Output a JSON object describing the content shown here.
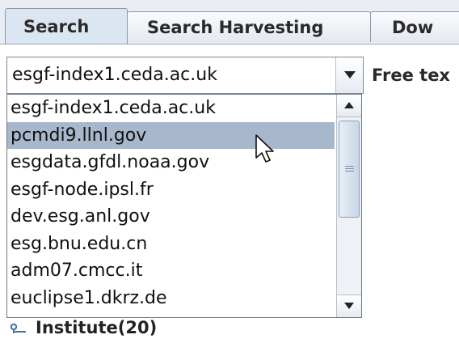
{
  "tabs": [
    {
      "label": "Search",
      "selected": true
    },
    {
      "label": "Search Harvesting",
      "selected": false
    },
    {
      "label": "Dow",
      "selected": false
    }
  ],
  "index_node_combo": {
    "selected_value": "esgf-index1.ceda.ac.uk",
    "arrow_icon": "chevron-down-icon"
  },
  "free_text_label": "Free tex",
  "dropdown": {
    "items": [
      {
        "label": "esgf-index1.ceda.ac.uk",
        "highlighted": false
      },
      {
        "label": "pcmdi9.llnl.gov",
        "highlighted": true
      },
      {
        "label": "esgdata.gfdl.noaa.gov",
        "highlighted": false
      },
      {
        "label": "esgf-node.ipsl.fr",
        "highlighted": false
      },
      {
        "label": "dev.esg.anl.gov",
        "highlighted": false
      },
      {
        "label": "esg.bnu.edu.cn",
        "highlighted": false
      },
      {
        "label": "adm07.cmcc.it",
        "highlighted": false
      },
      {
        "label": "euclipse1.dkrz.de",
        "highlighted": false
      }
    ]
  },
  "tree": {
    "facet_label": "Institute(20)",
    "icon": "tree-node-icon"
  },
  "colors": {
    "highlight": "#a8b8cc",
    "tab_selected": "#dce6f3",
    "border": "#7d8a99"
  }
}
